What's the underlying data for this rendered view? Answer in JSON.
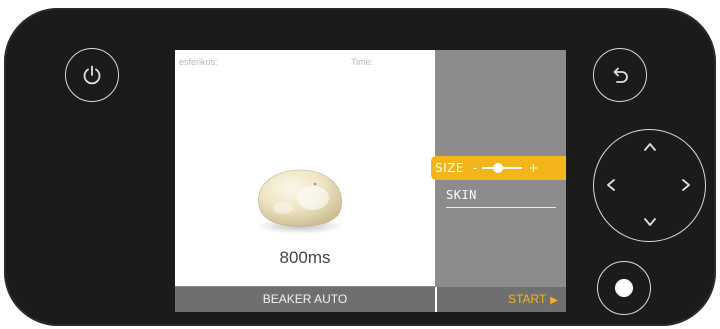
{
  "screen": {
    "header_left": "esferikos:",
    "header_right": "Time:",
    "duration": "800ms",
    "size_label": "SIZE",
    "size_minus": "-",
    "size_plus": "+",
    "size_level": 0.35,
    "skin_label": "SKIN",
    "mode_label": "BEAKER AUTO",
    "start_label": "START",
    "start_icon": "play-icon"
  },
  "controls": {
    "power_icon": "power-icon",
    "back_icon": "undo-arrow-icon",
    "up_icon": "chevron-up-icon",
    "down_icon": "chevron-down-icon",
    "left_icon": "chevron-left-icon",
    "right_icon": "chevron-right-icon",
    "record_icon": "record-dot-icon"
  },
  "colors": {
    "accent": "#f4b51a",
    "panel": "#1b1b1b",
    "side_panel": "#8c8c8c",
    "bottom_bar": "#6f6f6f"
  }
}
